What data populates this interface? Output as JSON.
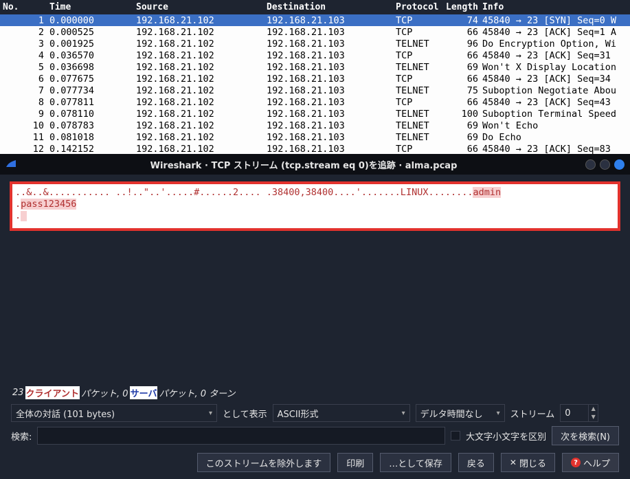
{
  "columns": {
    "no": "No.",
    "time": "Time",
    "source": "Source",
    "destination": "Destination",
    "protocol": "Protocol",
    "length": "Length",
    "info": "Info"
  },
  "packets": [
    {
      "no": "1",
      "time": "0.000000",
      "src": "192.168.21.102",
      "dst": "192.168.21.103",
      "prot": "TCP",
      "len": "74",
      "info": "45840 → 23 [SYN] Seq=0 W"
    },
    {
      "no": "2",
      "time": "0.000525",
      "src": "192.168.21.102",
      "dst": "192.168.21.103",
      "prot": "TCP",
      "len": "66",
      "info": "45840 → 23 [ACK] Seq=1 A"
    },
    {
      "no": "3",
      "time": "0.001925",
      "src": "192.168.21.102",
      "dst": "192.168.21.103",
      "prot": "TELNET",
      "len": "96",
      "info": "Do Encryption Option, Wi"
    },
    {
      "no": "4",
      "time": "0.036570",
      "src": "192.168.21.102",
      "dst": "192.168.21.103",
      "prot": "TCP",
      "len": "66",
      "info": "45840 → 23 [ACK] Seq=31 "
    },
    {
      "no": "5",
      "time": "0.036698",
      "src": "192.168.21.102",
      "dst": "192.168.21.103",
      "prot": "TELNET",
      "len": "69",
      "info": "Won't X Display Location"
    },
    {
      "no": "6",
      "time": "0.077675",
      "src": "192.168.21.102",
      "dst": "192.168.21.103",
      "prot": "TCP",
      "len": "66",
      "info": "45840 → 23 [ACK] Seq=34 "
    },
    {
      "no": "7",
      "time": "0.077734",
      "src": "192.168.21.102",
      "dst": "192.168.21.103",
      "prot": "TELNET",
      "len": "75",
      "info": "Suboption Negotiate Abou"
    },
    {
      "no": "8",
      "time": "0.077811",
      "src": "192.168.21.102",
      "dst": "192.168.21.103",
      "prot": "TCP",
      "len": "66",
      "info": "45840 → 23 [ACK] Seq=43 "
    },
    {
      "no": "9",
      "time": "0.078110",
      "src": "192.168.21.102",
      "dst": "192.168.21.103",
      "prot": "TELNET",
      "len": "100",
      "info": "Suboption Terminal Speed"
    },
    {
      "no": "10",
      "time": "0.078783",
      "src": "192.168.21.102",
      "dst": "192.168.21.103",
      "prot": "TELNET",
      "len": "69",
      "info": "Won't Echo"
    },
    {
      "no": "11",
      "time": "0.081018",
      "src": "192.168.21.102",
      "dst": "192.168.21.103",
      "prot": "TELNET",
      "len": "69",
      "info": "Do Echo"
    },
    {
      "no": "12",
      "time": "0.142152",
      "src": "192.168.21.102",
      "dst": "192.168.21.103",
      "prot": "TCP",
      "len": "66",
      "info": "45840 → 23 [ACK] Seq=83 "
    }
  ],
  "dialog": {
    "title": "Wireshark · TCP ストリーム (tcp.stream eq 0)を追跡 · alma.pcap",
    "stream_plain": "..&..&........... ..!..\"..'.....#......2.... .38400,38400....'.......LINUX........",
    "stream_hl1": "admin",
    "stream_mid": ".",
    "stream_hl2": "pass123456",
    "stream_tail": ".",
    "summary_prefix": "23 ",
    "summary_client": "クライアント",
    "summary_mid1": " パケット, 0 ",
    "summary_server": "サーバ",
    "summary_mid2": " パケット, 0 ターン",
    "combo_conv": "全体の対話 (101 bytes)",
    "lbl_showas": "として表示",
    "combo_format": "ASCII形式",
    "combo_delta": "デルタ時間なし",
    "lbl_stream": "ストリーム",
    "stream_no": "0",
    "lbl_search": "検索:",
    "chk_case": "大文字小文字を区別",
    "btn_find": "次を検索(N)",
    "btn_filter": "このストリームを除外します",
    "btn_print": "印刷",
    "btn_saveas": "…として保存",
    "btn_back": "戻る",
    "btn_close": "閉じる",
    "btn_help": "ヘルプ"
  }
}
